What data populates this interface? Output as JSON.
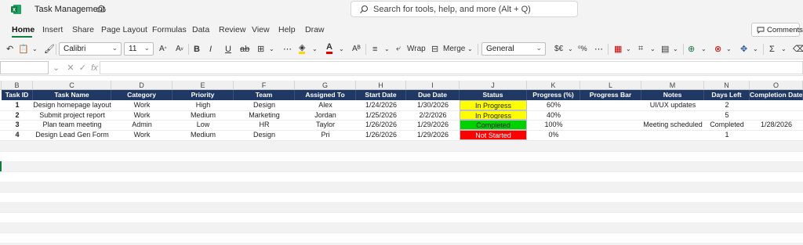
{
  "app": {
    "title": "Task Management",
    "search_placeholder": "Search for tools, help, and more (Alt + Q)",
    "accent": "#107c41"
  },
  "tabs": [
    "Home",
    "Insert",
    "Share",
    "Page Layout",
    "Formulas",
    "Data",
    "Review",
    "View",
    "Help",
    "Draw"
  ],
  "comments_label": "Comments",
  "ribbon": {
    "font_name": "Calibri",
    "font_size": "11",
    "wrap_label": "Wrap",
    "merge_label": "Merge",
    "number_format": "General",
    "currency_symbol": "$€"
  },
  "formula": {
    "fx_label": "fx"
  },
  "columns": [
    "B",
    "C",
    "D",
    "E",
    "F",
    "G",
    "H",
    "I",
    "J",
    "K",
    "L",
    "M",
    "N",
    "O"
  ],
  "headers": [
    "Task ID",
    "Task Name",
    "Category",
    "Priority",
    "Team",
    "Assigned To",
    "Start Date",
    "Due Date",
    "Status",
    "Progress (%)",
    "Progress Bar",
    "Notes",
    "Days Left",
    "Completion Date"
  ],
  "rows": [
    {
      "id": "1",
      "task": "Design homepage layout",
      "category": "Work",
      "priority": "High",
      "team": "Design",
      "assigned": "Alex",
      "start": "1/24/2026",
      "due": "1/30/2026",
      "status": "In Progress",
      "progress": "60%",
      "bar": "",
      "notes": "UI/UX updates",
      "days_left": "2",
      "completion": ""
    },
    {
      "id": "2",
      "task": "Submit project report",
      "category": "Work",
      "priority": "Medium",
      "team": "Marketing",
      "assigned": "Jordan",
      "start": "1/25/2026",
      "due": "2/2/2026",
      "status": "In Progress",
      "progress": "40%",
      "bar": "",
      "notes": "",
      "days_left": "5",
      "completion": ""
    },
    {
      "id": "3",
      "task": "Plan team meeting",
      "category": "Admin",
      "priority": "Low",
      "team": "HR",
      "assigned": "Taylor",
      "start": "1/26/2026",
      "due": "1/29/2026",
      "status": "Completed",
      "progress": "100%",
      "bar": "",
      "notes": "Meeting scheduled",
      "days_left": "Completed",
      "completion": "1/28/2026"
    },
    {
      "id": "4",
      "task": "Design Lead Gen Form",
      "category": "Work",
      "priority": "Medium",
      "team": "Design",
      "assigned": "Pri",
      "start": "1/26/2026",
      "due": "1/29/2026",
      "status": "Not Started",
      "progress": "0%",
      "bar": "",
      "notes": "",
      "days_left": "1",
      "completion": ""
    }
  ],
  "status_colors": {
    "In Progress": "#ffff00",
    "Completed": "#00d100",
    "Not Started": "#ff0000"
  },
  "header_color": "#1f3864"
}
